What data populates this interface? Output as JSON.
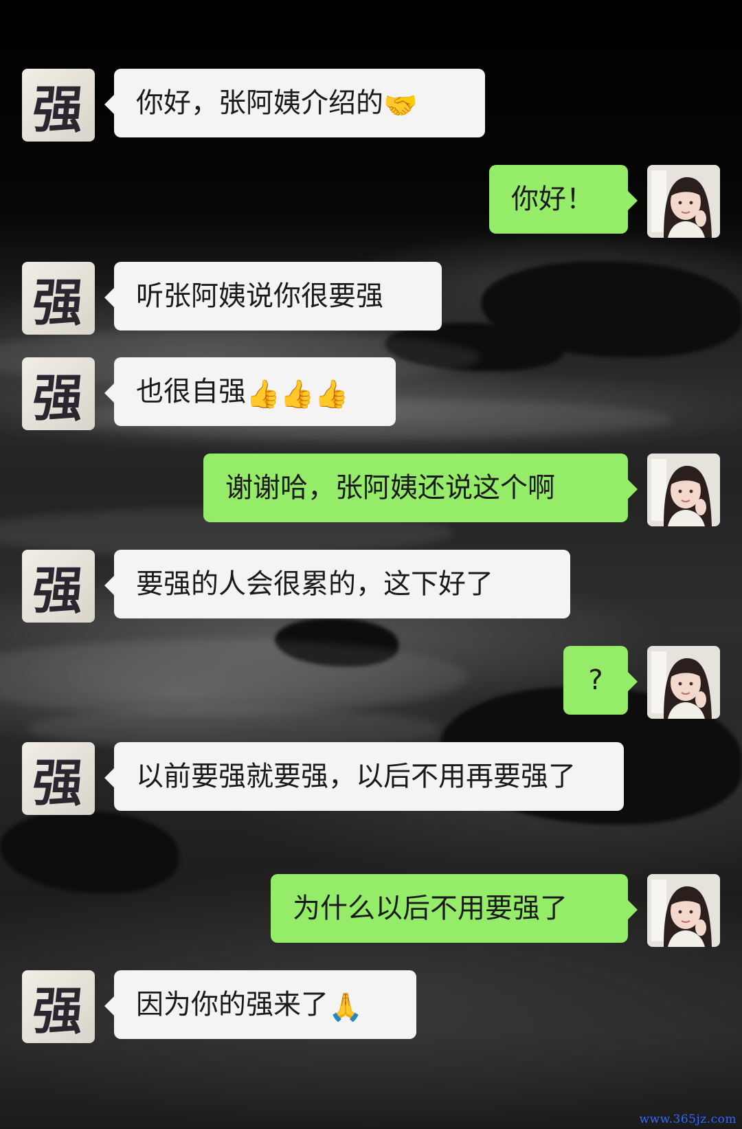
{
  "avatars": {
    "contact_char": "强"
  },
  "messages": [
    {
      "side": "left",
      "text": "你好，张阿姨介绍的",
      "emoji": "🤝"
    },
    {
      "side": "right",
      "text": "你好！"
    },
    {
      "side": "left",
      "text": "听张阿姨说你很要强"
    },
    {
      "side": "left",
      "text": "也很自强",
      "emoji": "👍👍👍"
    },
    {
      "side": "right",
      "text": "谢谢哈，张阿姨还说这个啊"
    },
    {
      "side": "left",
      "text": "要强的人会很累的，这下好了"
    },
    {
      "side": "right",
      "text": "?"
    },
    {
      "side": "left",
      "text": "以前要强就要强，以后不用再要强了"
    },
    {
      "side": "right",
      "text": "为什么以后不用要强了"
    },
    {
      "side": "left",
      "text": "因为你的强来了",
      "emoji": "🙏"
    }
  ],
  "watermark": "www.365jz.com",
  "colors": {
    "incoming_bubble": "#f4f4f4",
    "outgoing_bubble": "#95ec69",
    "watermark": "#2f6bff"
  }
}
